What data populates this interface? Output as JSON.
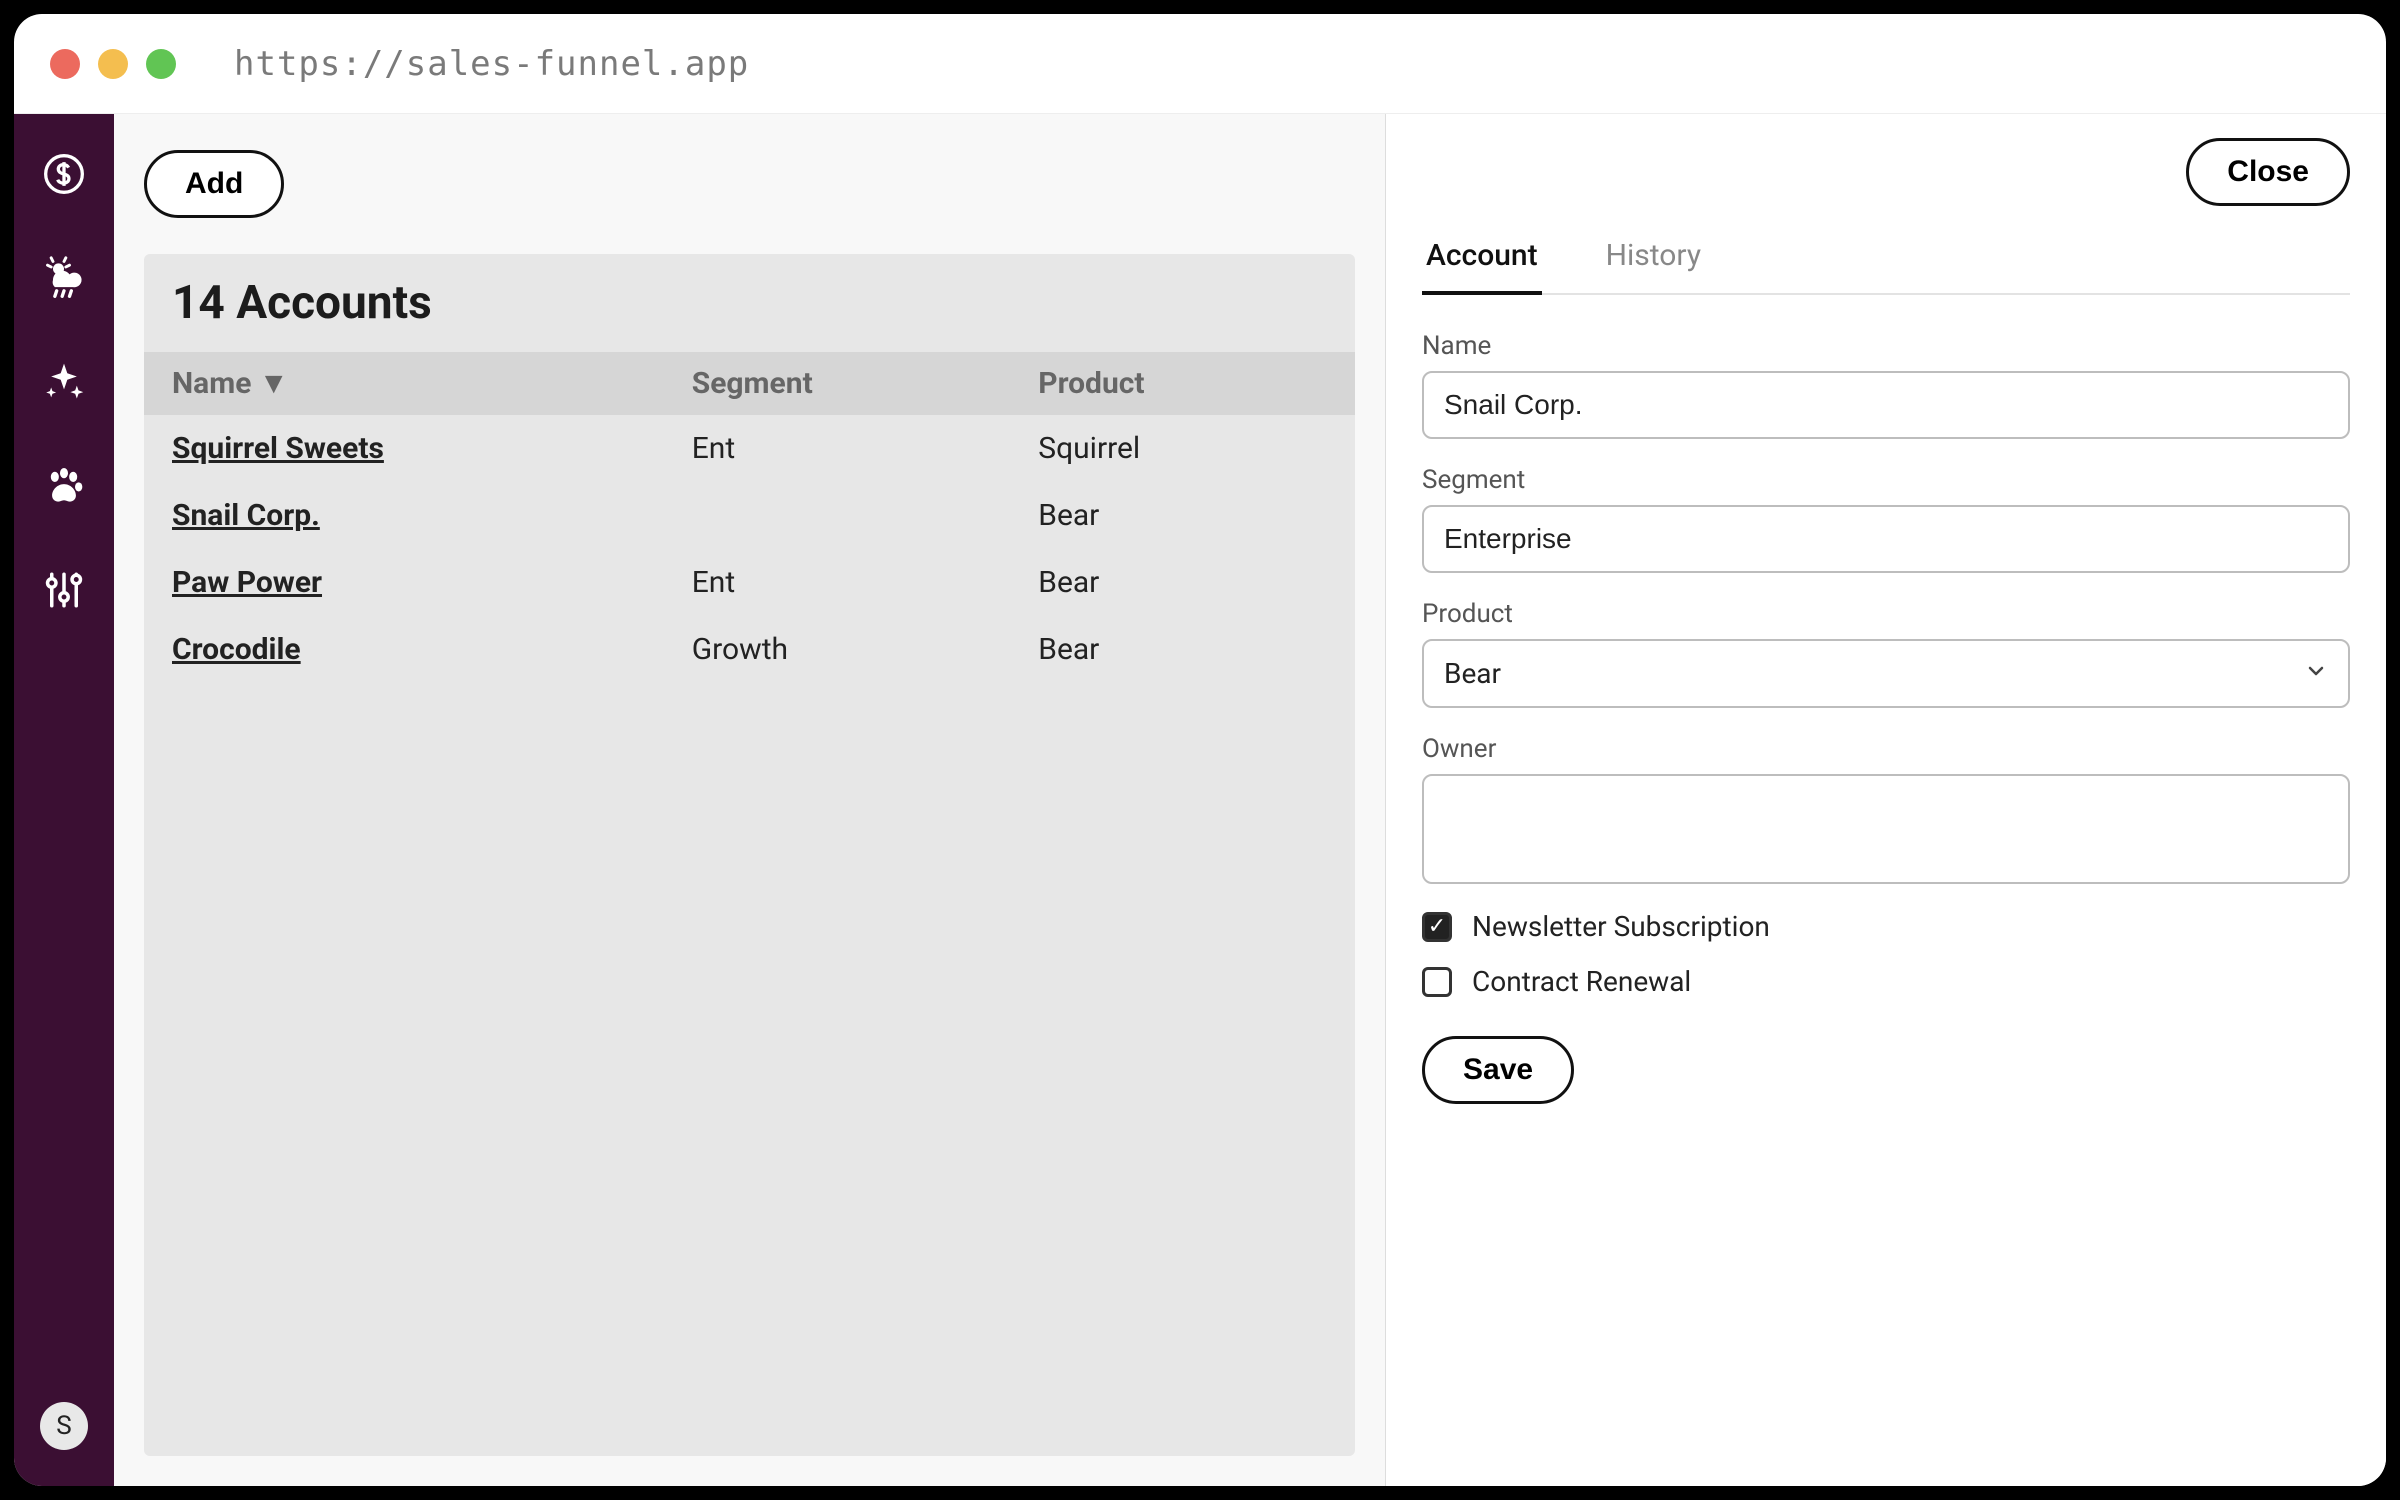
{
  "browser": {
    "url": "https://sales-funnel.app"
  },
  "sidebar": {
    "avatar_initial": "S"
  },
  "toolbar": {
    "add_label": "Add"
  },
  "list": {
    "title": "14 Accounts",
    "columns": {
      "name": "Name ▼",
      "segment": "Segment",
      "product": "Product"
    },
    "rows": [
      {
        "name": "Squirrel Sweets",
        "segment": "Ent",
        "product": "Squirrel"
      },
      {
        "name": "Snail Corp.",
        "segment": "",
        "product": "Bear"
      },
      {
        "name": "Paw Power",
        "segment": "Ent",
        "product": "Bear"
      },
      {
        "name": "Crocodile",
        "segment": "Growth",
        "product": "Bear"
      }
    ]
  },
  "detail": {
    "close_label": "Close",
    "tabs": {
      "account": "Account",
      "history": "History"
    },
    "fields": {
      "name": {
        "label": "Name",
        "value": "Snail Corp."
      },
      "segment": {
        "label": "Segment",
        "value": "Enterprise"
      },
      "product": {
        "label": "Product",
        "value": "Bear"
      },
      "owner": {
        "label": "Owner",
        "value": ""
      }
    },
    "checks": {
      "newsletter": {
        "label": "Newsletter Subscription",
        "checked": true
      },
      "renewal": {
        "label": "Contract Renewal",
        "checked": false
      }
    },
    "save_label": "Save"
  }
}
